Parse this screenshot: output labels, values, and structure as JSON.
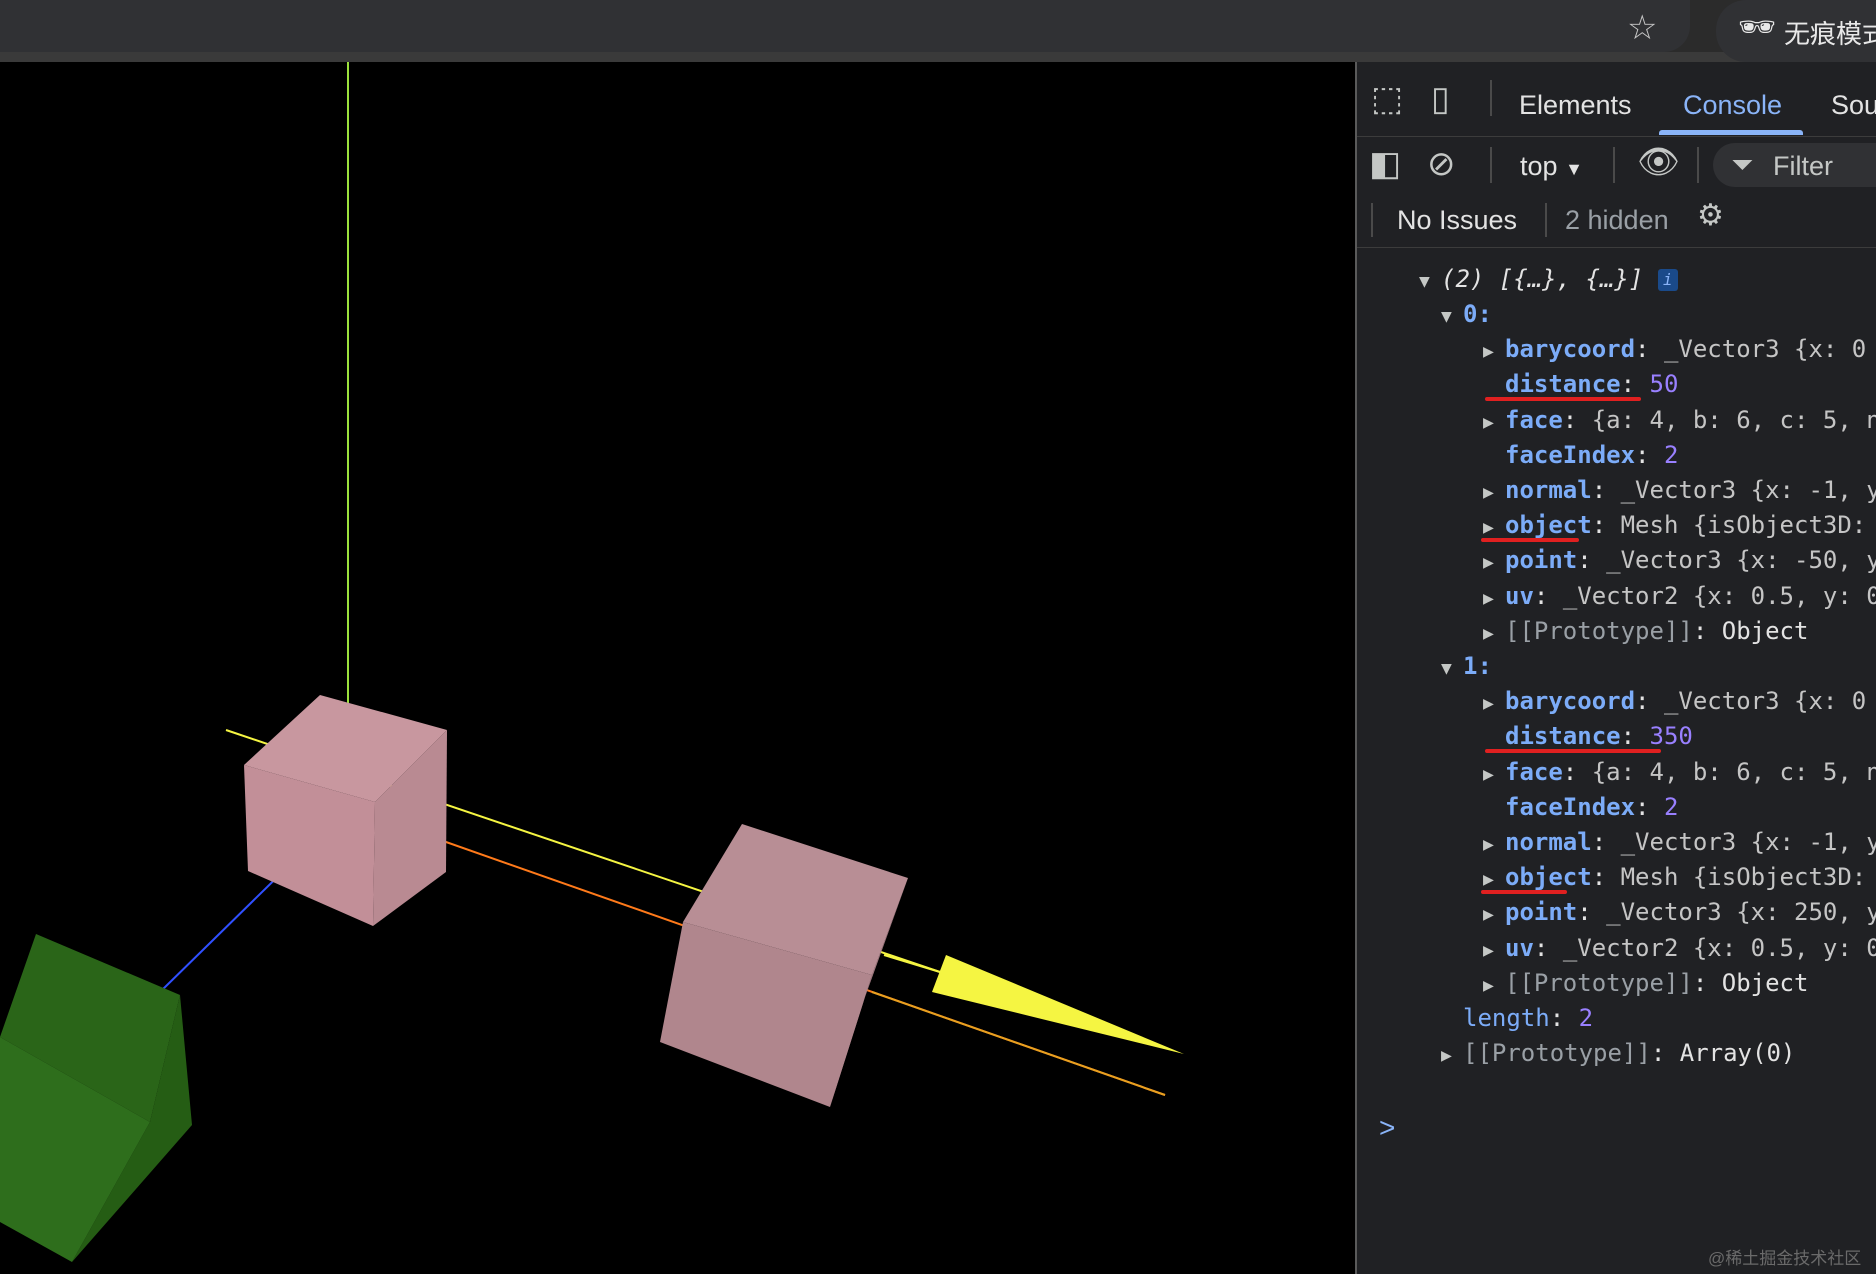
{
  "browser": {
    "star_icon": "star-icon",
    "incognito_label": "无痕模式",
    "incognito_icon": "incognito-icon"
  },
  "devtools": {
    "tabs": [
      "Elements",
      "Console",
      "Sou"
    ],
    "active_tab": "Console",
    "context": "top",
    "filter_label": "Filter",
    "issues_label": "No Issues",
    "hidden_label": "2 hidden"
  },
  "console": {
    "array_summary": "(2) [{…}, {…}]",
    "info_badge": "i",
    "items": [
      {
        "index": "0:",
        "props": [
          {
            "key": "barycoord",
            "value": "_Vector3 {x: 0",
            "expandable": true
          },
          {
            "key": "distance",
            "value": "50",
            "expandable": false
          },
          {
            "key": "face",
            "value": "{a: 4, b: 6, c: 5, n",
            "expandable": true
          },
          {
            "key": "faceIndex",
            "value": "2",
            "expandable": false
          },
          {
            "key": "normal",
            "value": "_Vector3 {x: -1, y",
            "expandable": true
          },
          {
            "key": "object",
            "value": "Mesh {isObject3D:",
            "expandable": true
          },
          {
            "key": "point",
            "value": "_Vector3 {x: -50, y",
            "expandable": true
          },
          {
            "key": "uv",
            "value": "_Vector2 {x: 0.5, y: 0",
            "expandable": true
          },
          {
            "key": "[[Prototype]]",
            "value": "Object",
            "expandable": true
          }
        ]
      },
      {
        "index": "1:",
        "props": [
          {
            "key": "barycoord",
            "value": "_Vector3 {x: 0",
            "expandable": true
          },
          {
            "key": "distance",
            "value": "350",
            "expandable": false
          },
          {
            "key": "face",
            "value": "{a: 4, b: 6, c: 5, n",
            "expandable": true
          },
          {
            "key": "faceIndex",
            "value": "2",
            "expandable": false
          },
          {
            "key": "normal",
            "value": "_Vector3 {x: -1, y",
            "expandable": true
          },
          {
            "key": "object",
            "value": "Mesh {isObject3D:",
            "expandable": true
          },
          {
            "key": "point",
            "value": "_Vector3 {x: 250, y",
            "expandable": true
          },
          {
            "key": "uv",
            "value": "_Vector2 {x: 0.5, y: 0",
            "expandable": true
          },
          {
            "key": "[[Prototype]]",
            "value": "Object",
            "expandable": true
          }
        ]
      }
    ],
    "length_key": "length",
    "length_value": "2",
    "proto_key": "[[Prototype]]",
    "proto_value": "Array(0)",
    "prompt": ">"
  },
  "scene": {
    "background": "#000000",
    "green_cube_color": "#2d6b1a",
    "pink_cube_color": "#c48e98",
    "ray_color": "#f5f542",
    "axis_x_color": "#ff7a1a",
    "axis_y_color": "#9be03c",
    "axis_z_color": "#3050ff"
  },
  "watermark": "@稀土掘金技术社区"
}
